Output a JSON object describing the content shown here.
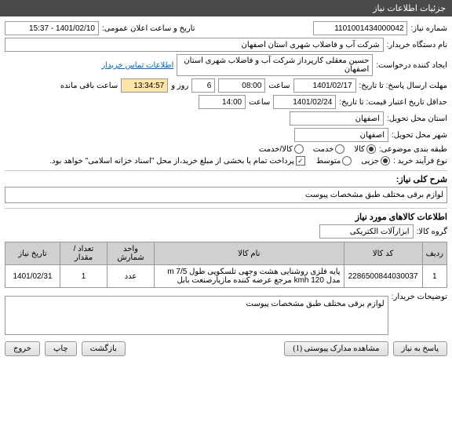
{
  "header": "جزئیات اطلاعات نیاز",
  "fields": {
    "number_label": "شماره نیاز:",
    "number": "1101001434000042",
    "public_date_label": "تاریخ و ساعت اعلان عمومی:",
    "public_date": "1401/02/10 - 15:37",
    "buyer_label": "نام دستگاه خریدار:",
    "buyer": "شرکت آب و فاضلاب شهری استان اصفهان",
    "creator_label": "ایجاد کننده درخواست:",
    "creator": "حسین معقلی کارپرداز شرکت آب و فاضلاب شهری استان اصفهان",
    "contact_link": "اطلاعات تماس خریدار",
    "deadline_label": "مهلت ارسال پاسخ: تا تاریخ:",
    "deadline_date": "1401/02/17",
    "time_label": "ساعت",
    "deadline_time": "08:00",
    "days": "6",
    "days_label": "روز و",
    "countdown": "13:34:57",
    "remaining_label": "ساعت باقی مانده",
    "validity_label": "حداقل تاریخ اعتبار قیمت: تا تاریخ:",
    "validity_date": "1401/02/24",
    "validity_time": "14:00",
    "province_label": "استان محل تحویل:",
    "province": "اصفهان",
    "city_label": "شهر محل تحویل:",
    "city": "اصفهان",
    "category_label": "طبقه بندی موضوعی:",
    "cat_goods": "کالا",
    "cat_service": "خدمت",
    "cat_both": "کالا/خدمت",
    "process_label": "نوع فرآیند خرید :",
    "proc_small": "جزیی",
    "proc_medium": "متوسط",
    "proc_note": "پرداخت تمام یا بخشی از مبلغ خرید،از محل \"اسناد خزانه اسلامی\" خواهد بود.",
    "desc_title": "شرح کلی نیاز:",
    "desc_text": "لوازم برقی مختلف طبق مشخصات پیوست",
    "items_title": "اطلاعات کالاهای مورد نیاز",
    "group_label": "گروه کالا:",
    "group_value": "ابزارآلات الکتریکی",
    "notes_label": "توضیحات خریدار:",
    "notes_text": "لوازم برقی مختلف طبق مشخصات پیوست"
  },
  "table": {
    "headers": {
      "row": "ردیف",
      "code": "کد کالا",
      "name": "نام کالا",
      "unit": "واحد شمارش",
      "qty": "تعداد / مقدار",
      "date": "تاریخ نیاز"
    },
    "rows": [
      {
        "row": "1",
        "code": "2286500844030037",
        "name": "پایه فلزی روشنایی هشت وجهی تلسکوپی طول m 7/5 مدل kmh 120 مرجع عرضه کننده مازیارصنعت بابل",
        "unit": "عدد",
        "qty": "1",
        "date": "1401/02/31"
      }
    ]
  },
  "buttons": {
    "reply": "پاسخ به نیاز",
    "attachments": "مشاهده مدارک پیوستی (1)",
    "back": "بازگشت",
    "print": "چاپ",
    "exit": "خروج"
  }
}
